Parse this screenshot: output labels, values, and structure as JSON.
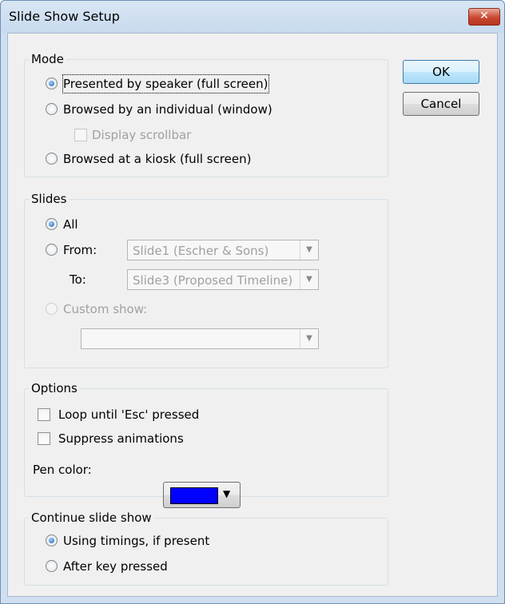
{
  "window": {
    "title": "Slide Show Setup",
    "close_icon": "close-icon"
  },
  "buttons": {
    "ok": "OK",
    "cancel": "Cancel"
  },
  "mode": {
    "legend": "Mode",
    "presented": "Presented by speaker (full screen)",
    "browsed_individual": "Browsed by an individual (window)",
    "display_scrollbar": "Display scrollbar",
    "kiosk": "Browsed at a kiosk (full screen)",
    "selected": "presented"
  },
  "slides": {
    "legend": "Slides",
    "all": "All",
    "from_label": "From:",
    "from_value": "Slide1 (Escher & Sons)",
    "to_label": "To:",
    "to_value": "Slide3 (Proposed Timeline)",
    "custom_show": "Custom show:",
    "custom_value": "",
    "selected": "all"
  },
  "options": {
    "legend": "Options",
    "loop": "Loop until 'Esc' pressed",
    "suppress": "Suppress animations",
    "pen_color_label": "Pen color:",
    "pen_color": "#0000ff"
  },
  "continue": {
    "legend": "Continue slide show",
    "timings": "Using timings, if present",
    "after_key": "After key pressed",
    "selected": "timings"
  }
}
